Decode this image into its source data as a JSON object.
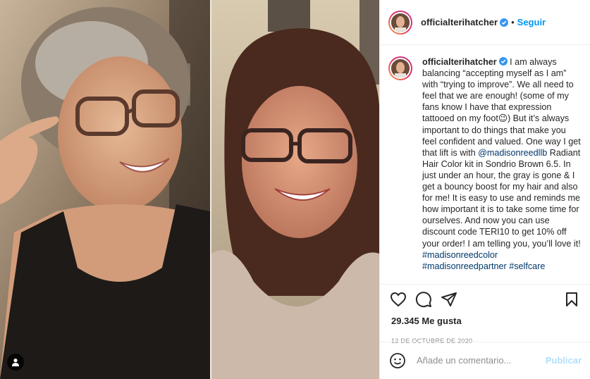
{
  "post": {
    "username": "officialterihatcher",
    "verified": true,
    "separator": "•",
    "follow_label": "Seguir"
  },
  "caption": {
    "username": "officialterihatcher",
    "text_1": " I am always balancing “accepting myself as I am” with “trying to improve”. We all need to feel that we are enough! (some of my fans know I have that expression tattooed on my foot",
    "emoji": "😉",
    "text_2": ") But it’s always important to do things that make you feel confident and valued. One way I get that lift is with ",
    "mention": "@madisonreedllb",
    "text_3": " Radiant Hair Color kit in Sondrio Brown 6.5. In just under an hour, the gray is gone & I get a bouncy boost for my hair and also for me! It is easy to use and reminds me how important it is to take some time for ourselves. And now you can use discount code TERI10 to get 10% off your order! I am telling you, you’ll love it! ",
    "hashtag_1": "#madisonreedcolor",
    "hashtag_2": "#madisonreedpartner",
    "hashtag_3": "#selfcare"
  },
  "actions": {
    "like_icon": "heart-icon",
    "comment_icon": "comment-icon",
    "share_icon": "paper-plane-icon",
    "save_icon": "bookmark-icon"
  },
  "likes": {
    "count": "29.345",
    "label": "Me gusta"
  },
  "date": "12 DE OCTUBRE DE 2020",
  "comment": {
    "emoji_icon": "smiley-icon",
    "placeholder": "Añade un comentario...",
    "publish_label": "Publicar"
  },
  "colors": {
    "accent": "#0095f6",
    "publish_disabled": "#b2dffc",
    "link": "#00376b",
    "muted": "#8e8e8e",
    "border": "#efefef"
  }
}
